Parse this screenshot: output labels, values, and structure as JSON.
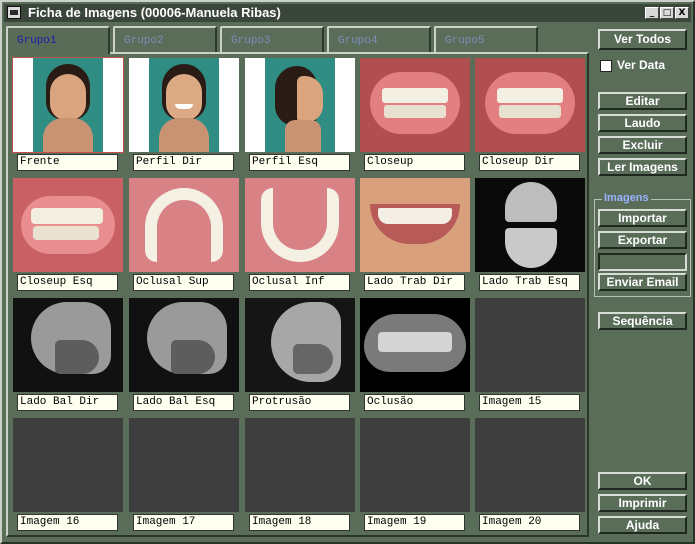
{
  "window": {
    "title": "Ficha de Imagens (00006-Manuela Ribas)"
  },
  "window_controls": [
    "_",
    "□",
    "X"
  ],
  "tabs": [
    "Grupo1",
    "Grupo2",
    "Grupo3",
    "Grupo4",
    "Grupo5"
  ],
  "images": [
    {
      "label": "Frente",
      "kind": "face-front"
    },
    {
      "label": "Perfil Dir",
      "kind": "face-smile"
    },
    {
      "label": "Perfil Esq",
      "kind": "face-profile"
    },
    {
      "label": "Closeup",
      "kind": "teeth-closeup"
    },
    {
      "label": "Closeup Dir",
      "kind": "teeth-closeup"
    },
    {
      "label": "Closeup Esq",
      "kind": "teeth-side"
    },
    {
      "label": "Oclusal Sup",
      "kind": "occlusal"
    },
    {
      "label": "Oclusal Inf",
      "kind": "occlusal-inf"
    },
    {
      "label": "Lado Trab Dir",
      "kind": "smile"
    },
    {
      "label": "Lado Trab Esq",
      "kind": "xray-arch"
    },
    {
      "label": "Lado Bal Dir",
      "kind": "xray-ceph"
    },
    {
      "label": "Lado Bal Esq",
      "kind": "xray-ceph"
    },
    {
      "label": "Protrusão",
      "kind": "xray-ceph2"
    },
    {
      "label": "Oclusão",
      "kind": "xray-pan"
    },
    {
      "label": "Imagem 15",
      "kind": "empty"
    },
    {
      "label": "Imagem 16",
      "kind": "empty"
    },
    {
      "label": "Imagem 17",
      "kind": "empty"
    },
    {
      "label": "Imagem 18",
      "kind": "empty"
    },
    {
      "label": "Imagem 19",
      "kind": "empty"
    },
    {
      "label": "Imagem 20",
      "kind": "empty"
    }
  ],
  "sidebar": {
    "ver_todos": "Ver Todos",
    "ver_data": "Ver Data",
    "editar": "Editar",
    "laudo": "Laudo",
    "excluir": "Excluir",
    "ler_imagens": "Ler Imagens",
    "imagens_group": "Imagens",
    "importar": "Importar",
    "exportar": "Exportar",
    "enviar_email": "Enviar Email",
    "sequencia": "Sequência",
    "ok": "OK",
    "imprimir": "Imprimir",
    "ajuda": "Ajuda"
  }
}
